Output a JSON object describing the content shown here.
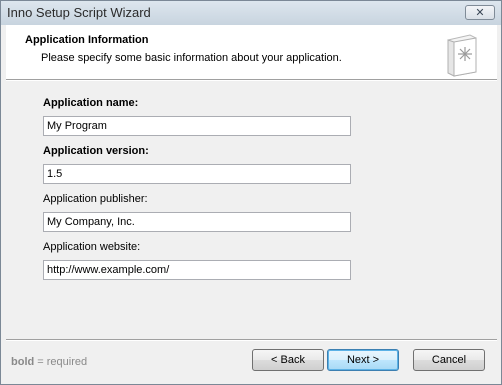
{
  "window": {
    "title": "Inno Setup Script Wizard",
    "close_label": "✕"
  },
  "header": {
    "title": "Application Information",
    "subtitle": "Please specify some basic information about your application."
  },
  "fields": [
    {
      "label": "Application name:",
      "value": "My Program",
      "required": true
    },
    {
      "label": "Application version:",
      "value": "1.5",
      "required": true
    },
    {
      "label": "Application publisher:",
      "value": "My Company, Inc.",
      "required": false
    },
    {
      "label": "Application website:",
      "value": "http://www.example.com/",
      "required": false
    }
  ],
  "footer": {
    "legend_bold": "bold",
    "legend_rest": " = required",
    "back_label": "< Back",
    "next_label": "Next >",
    "cancel_label": "Cancel"
  }
}
